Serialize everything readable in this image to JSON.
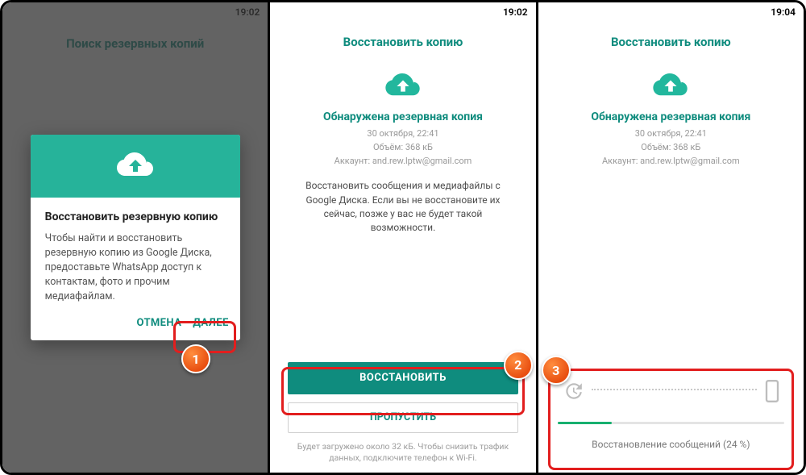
{
  "screen1": {
    "time": "19:02",
    "title": "Поиск резервных копий",
    "dialog": {
      "title": "Восстановить резервную копию",
      "body": "Чтобы найти и восстановить резервную копию из Google Диска, предоставьте WhatsApp доступ к контактам, фото и прочим медиафайлам.",
      "cancel": "ОТМЕНА",
      "next": "ДАЛЕЕ"
    },
    "badge": "1"
  },
  "screen2": {
    "time": "19:02",
    "title": "Восстановить копию",
    "found": "Обнаружена резервная копия",
    "meta_date": "30 октября, 22:41",
    "meta_size": "Объём: 368 кБ",
    "meta_account": "Аккаунт: and.rew.lptw@gmail.com",
    "desc": "Восстановить сообщения и медиафайлы с Google Диска. Если вы не восстановите их сейчас, позже у вас не будет такой возможности.",
    "restore": "ВОССТАНОВИТЬ",
    "skip": "ПРОПУСТИТЬ",
    "hint": "Будет загружено около 32 кБ. Чтобы снизить трафик данных, подключите телефон к Wi-Fi.",
    "badge": "2"
  },
  "screen3": {
    "time": "19:04",
    "title": "Восстановить копию",
    "found": "Обнаружена резервная копия",
    "meta_date": "30 октября, 22:41",
    "meta_size": "Объём: 368 кБ",
    "meta_account": "Аккаунт: and.rew.lptw@gmail.com",
    "progress_percent": 24,
    "progress_label": "Восстановление сообщений (24 %)",
    "badge": "3"
  }
}
